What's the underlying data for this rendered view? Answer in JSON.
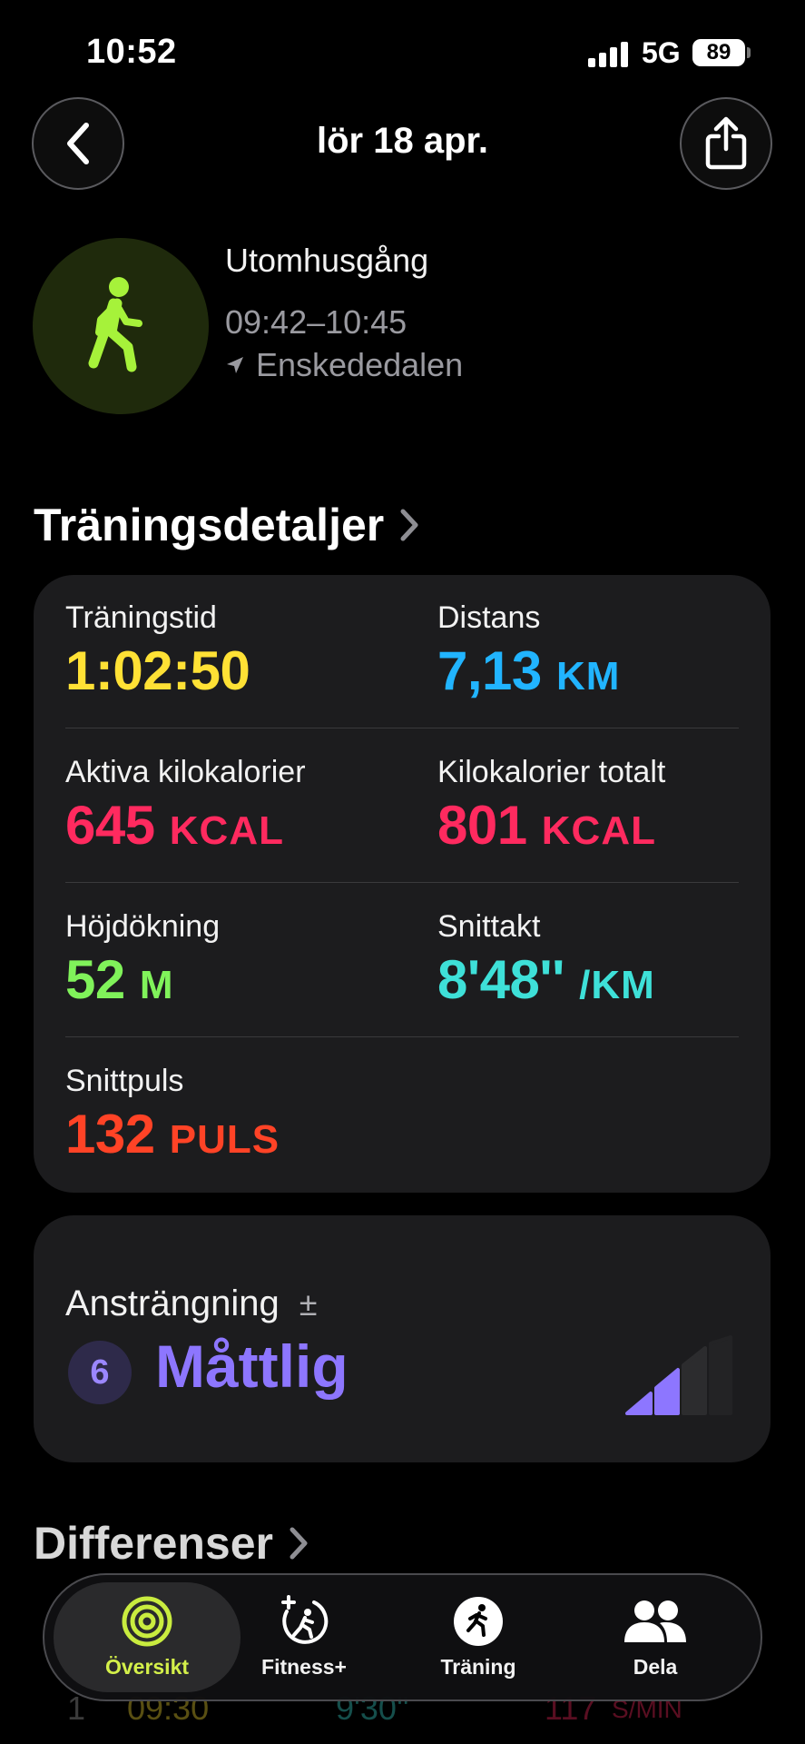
{
  "status_bar": {
    "time": "10:52",
    "network": "5G",
    "battery": "89"
  },
  "nav": {
    "title": "lör 18 apr."
  },
  "workout": {
    "title": "Utomhusgång",
    "time_range": "09:42–10:45",
    "location": "Enskededalen"
  },
  "details": {
    "heading": "Träningsdetaljer",
    "metrics": [
      {
        "label": "Träningstid",
        "value": "1:02:50",
        "unit": "",
        "color": "#ffe135"
      },
      {
        "label": "Distans",
        "value": "7,13",
        "unit": "KM",
        "color": "#21b4ff"
      },
      {
        "label": "Aktiva kilokalorier",
        "value": "645",
        "unit": "KCAL",
        "color": "#ff2a5f"
      },
      {
        "label": "Kilokalorier totalt",
        "value": "801",
        "unit": "KCAL",
        "color": "#ff2a5f"
      },
      {
        "label": "Höjdökning",
        "value": "52",
        "unit": "M",
        "color": "#80f25a"
      },
      {
        "label": "Snittakt",
        "value": "8'48''",
        "unit": "/KM",
        "color": "#3ee0d8"
      },
      {
        "label": "Snittpuls",
        "value": "132",
        "unit": "PULS",
        "color": "#ff4326"
      }
    ]
  },
  "effort": {
    "label": "Ansträngning",
    "adjust_symbol": "±",
    "level": "6",
    "description": "Måttlig",
    "color": "#8d76ff"
  },
  "splits": {
    "heading": "Differenser",
    "first_row": {
      "index": "1",
      "time": "09:30",
      "pace": "9'30''",
      "cadence": "117",
      "cadence_unit": "S/MIN"
    }
  },
  "tabbar": {
    "tabs": [
      {
        "label": "Översikt",
        "active": true
      },
      {
        "label": "Fitness+",
        "active": false
      },
      {
        "label": "Träning",
        "active": false
      },
      {
        "label": "Dela",
        "active": false
      }
    ]
  }
}
